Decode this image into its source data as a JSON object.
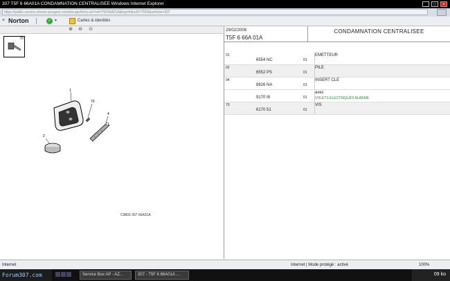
{
  "window": {
    "title": "307   T5F 6 66A01A   CONDAMNATION CENTRALISEE   Windows Internet Explorer"
  },
  "address_bar": {
    "url": "https://public.service.citroen-peugeot.com/docapv/fiche.do?ref=T5F66A01A&lng=fr&ref2=T5F6&vehicle=307"
  },
  "norton_toolbar": {
    "logo": "Norton",
    "cards_label": "Cartes & identités"
  },
  "catalog": {
    "thumbnail_number": "70",
    "diagram_labels": [
      "1",
      "2",
      "70",
      "4"
    ],
    "diagram_reference": "C9800    307 66A01A",
    "header": {
      "date": "29/02/2008",
      "reference": "T5F 6 66A 01A",
      "title": "CONDAMNATION CENTRALISEE"
    },
    "rows": [
      {
        "item": "01",
        "ref": "6554 NC",
        "qty": "01",
        "desc": "EMETTEUR",
        "desc2": ""
      },
      {
        "item": "02",
        "ref": "6552 PS",
        "qty": "01",
        "desc": "PILE",
        "desc2": ""
      },
      {
        "item": "04",
        "ref": "8826 NA",
        "qty": "01",
        "desc": "INSERT CLE",
        "desc2": ""
      },
      {
        "item": "",
        "ref": "9170 I8",
        "qty": "01",
        "desc": "avec",
        "desc2": "VOLETS ELECTRIQUES ALARME"
      },
      {
        "item": "70",
        "ref": "6170 51",
        "qty": "01",
        "desc": "VIS",
        "desc2": ""
      }
    ]
  },
  "status_bar": {
    "left": "Internet",
    "zone": "Internet | Mode protégé : activé",
    "zoom": "100%"
  },
  "taskbar": {
    "start_label": "Forum307.com",
    "buttons": [
      "Service Box AP - AZ...",
      "307 - T5F 6 66A01A ..."
    ],
    "clock": "09 ko"
  }
}
